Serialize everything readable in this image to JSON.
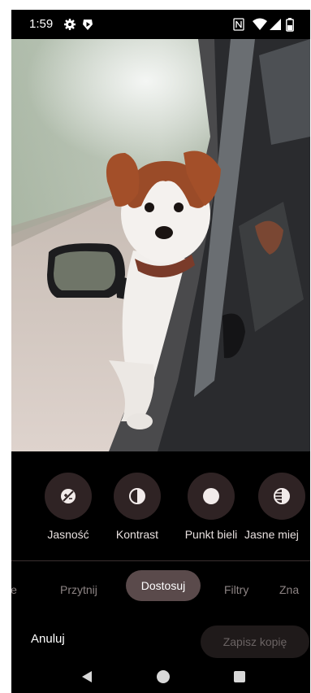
{
  "status_bar": {
    "time": "1:59",
    "icons": [
      "gear-icon",
      "shield-play-icon",
      "nfc-icon",
      "wifi-icon",
      "signal-icon",
      "battery-icon"
    ]
  },
  "photo": {
    "description_icon": "dog-in-car-photo"
  },
  "adjust_tools": [
    {
      "label": "Jasność",
      "icon": "brightness-icon"
    },
    {
      "label": "Kontrast",
      "icon": "contrast-icon"
    },
    {
      "label": "Punkt bieli",
      "icon": "white-point-icon"
    },
    {
      "label": "Jasne miej",
      "icon": "highlights-icon"
    }
  ],
  "tabs": {
    "partial_left": "ie",
    "crop": "Przytnij",
    "adjust": "Dostosuj",
    "filters": "Filtry",
    "partial_right": "Zna"
  },
  "actions": {
    "cancel": "Anuluj",
    "save_copy": "Zapisz kopię"
  },
  "nav": [
    "back-icon",
    "home-icon",
    "recents-icon"
  ],
  "colors": {
    "panel_bg": "#000000",
    "tool_circle": "#2f2324",
    "active_tab": "#5a4a4b",
    "disabled_button": "#1f1a1a"
  }
}
